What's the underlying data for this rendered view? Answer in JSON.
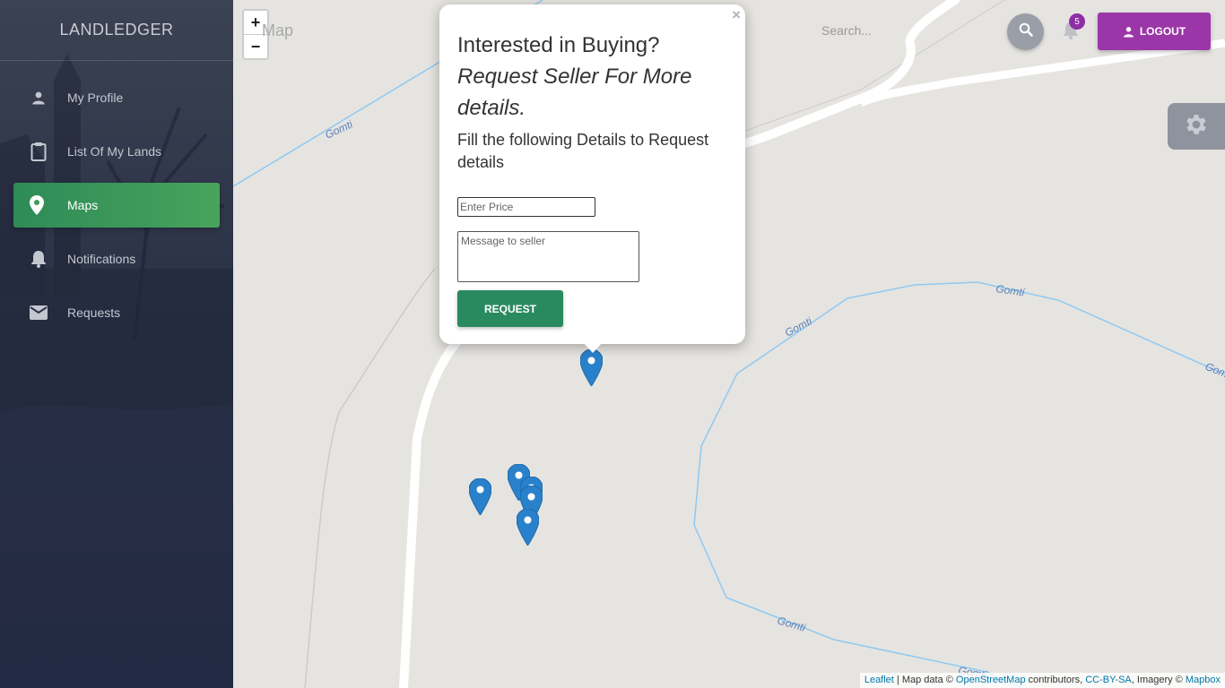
{
  "sidebar": {
    "brand": "LANDLEDGER",
    "items": [
      {
        "label": "My Profile",
        "icon": "person-icon"
      },
      {
        "label": "List Of My Lands",
        "icon": "clipboard-icon"
      },
      {
        "label": "Maps",
        "icon": "map-pin-icon",
        "active": true
      },
      {
        "label": "Notifications",
        "icon": "bell-icon"
      },
      {
        "label": "Requests",
        "icon": "mail-icon"
      }
    ]
  },
  "header": {
    "title": "Map",
    "search_placeholder": "Search...",
    "notification_count": "5",
    "logout_label": "LOGOUT"
  },
  "map": {
    "zoom_in": "+",
    "zoom_out": "−",
    "river_labels": [
      "Gomti",
      "Gomti",
      "Gomti",
      "Gomti",
      "Gomti",
      "Gomti"
    ],
    "attribution": {
      "leaflet": "Leaflet",
      "sep1": " | Map data © ",
      "osm": "OpenStreetMap",
      "sep2": " contributors, ",
      "license": "CC-BY-SA",
      "sep3": ", Imagery © ",
      "mapbox": "Mapbox"
    }
  },
  "popup": {
    "close": "×",
    "title": "Interested in Buying?",
    "subtitle": "Request Seller For More details.",
    "instructions": "Fill the following Details to Request details",
    "price_placeholder": "Enter Price",
    "message_placeholder": "Message to seller",
    "request_label": "REQUEST"
  },
  "colors": {
    "active_nav": "#2e8b57",
    "logout": "#9b36a8",
    "request_button": "#2a8a5f",
    "river": "#8ec9f2",
    "marker": "#2a81cb"
  }
}
